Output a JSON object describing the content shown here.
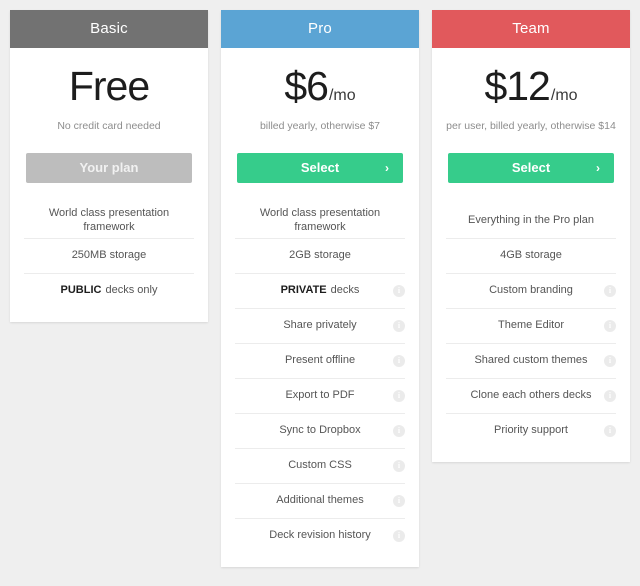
{
  "page": {
    "background_color": "#efefef",
    "accent_colors": {
      "basic": "#727272",
      "pro": "#5ba4d4",
      "team": "#e1595c",
      "select_green": "#36cc8b",
      "disabled_gray": "#bdbdbd"
    }
  },
  "plans": [
    {
      "id": "basic",
      "title": "Basic",
      "price_main": "Free",
      "price_suffix": "",
      "price_note": "No credit card needed",
      "cta_label": "Your plan",
      "cta_state": "disabled",
      "cta_has_chevron": false,
      "features": [
        {
          "text": "World class presentation framework",
          "bold_prefix": "",
          "has_info": false
        },
        {
          "text": "250MB storage",
          "bold_prefix": "",
          "has_info": false
        },
        {
          "text": "decks only",
          "bold_prefix": "PUBLIC",
          "has_info": false
        }
      ]
    },
    {
      "id": "pro",
      "title": "Pro",
      "price_main": "$6",
      "price_suffix": "/mo",
      "price_note": "billed yearly, otherwise $7",
      "cta_label": "Select",
      "cta_state": "enabled",
      "cta_has_chevron": true,
      "chevron_glyph": "›",
      "features": [
        {
          "text": "World class presentation framework",
          "bold_prefix": "",
          "has_info": false
        },
        {
          "text": "2GB storage",
          "bold_prefix": "",
          "has_info": false
        },
        {
          "text": "decks",
          "bold_prefix": "PRIVATE",
          "has_info": true
        },
        {
          "text": "Share privately",
          "bold_prefix": "",
          "has_info": true
        },
        {
          "text": "Present offline",
          "bold_prefix": "",
          "has_info": true
        },
        {
          "text": "Export to PDF",
          "bold_prefix": "",
          "has_info": true
        },
        {
          "text": "Sync to Dropbox",
          "bold_prefix": "",
          "has_info": true
        },
        {
          "text": "Custom CSS",
          "bold_prefix": "",
          "has_info": true
        },
        {
          "text": "Additional themes",
          "bold_prefix": "",
          "has_info": true
        },
        {
          "text": "Deck revision history",
          "bold_prefix": "",
          "has_info": true
        }
      ]
    },
    {
      "id": "team",
      "title": "Team",
      "price_main": "$12",
      "price_suffix": "/mo",
      "price_note": "per user, billed yearly, otherwise $14",
      "cta_label": "Select",
      "cta_state": "enabled",
      "cta_has_chevron": true,
      "chevron_glyph": "›",
      "features": [
        {
          "text": "Everything in the Pro plan",
          "bold_prefix": "",
          "has_info": false
        },
        {
          "text": "4GB storage",
          "bold_prefix": "",
          "has_info": false
        },
        {
          "text": "Custom branding",
          "bold_prefix": "",
          "has_info": true
        },
        {
          "text": "Theme Editor",
          "bold_prefix": "",
          "has_info": true
        },
        {
          "text": "Shared custom themes",
          "bold_prefix": "",
          "has_info": true
        },
        {
          "text": "Clone each others decks",
          "bold_prefix": "",
          "has_info": true
        },
        {
          "text": "Priority support",
          "bold_prefix": "",
          "has_info": true
        }
      ]
    }
  ],
  "icons": {
    "info_glyph": "i",
    "info_name": "info-icon"
  }
}
